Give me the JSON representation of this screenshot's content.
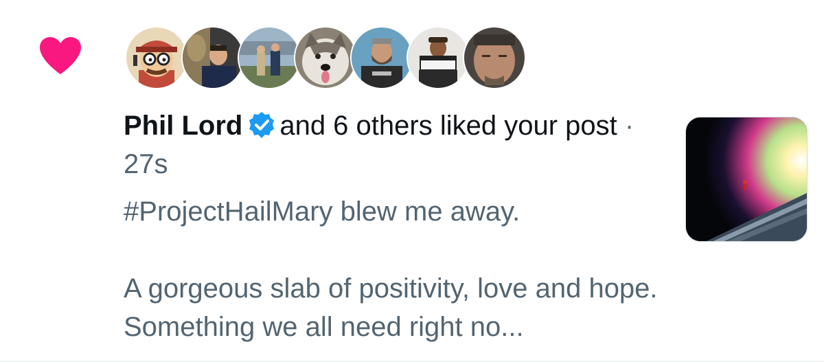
{
  "colors": {
    "heart": "#f91880",
    "verified": "#1d9bf0",
    "primary_text": "#0f1419",
    "secondary_text": "#536471"
  },
  "icons": {
    "like": "heart-icon",
    "verified": "verified-badge-icon"
  },
  "notification": {
    "actor_name": "Phil Lord",
    "summary": "and 6 others liked your post",
    "separator": "·",
    "timestamp": "27s",
    "post_line_1": "#ProjectHailMary blew me away.",
    "post_line_2": "A gorgeous slab of positivity, love and hope. Something we all need right no..."
  },
  "avatar_count": 7
}
